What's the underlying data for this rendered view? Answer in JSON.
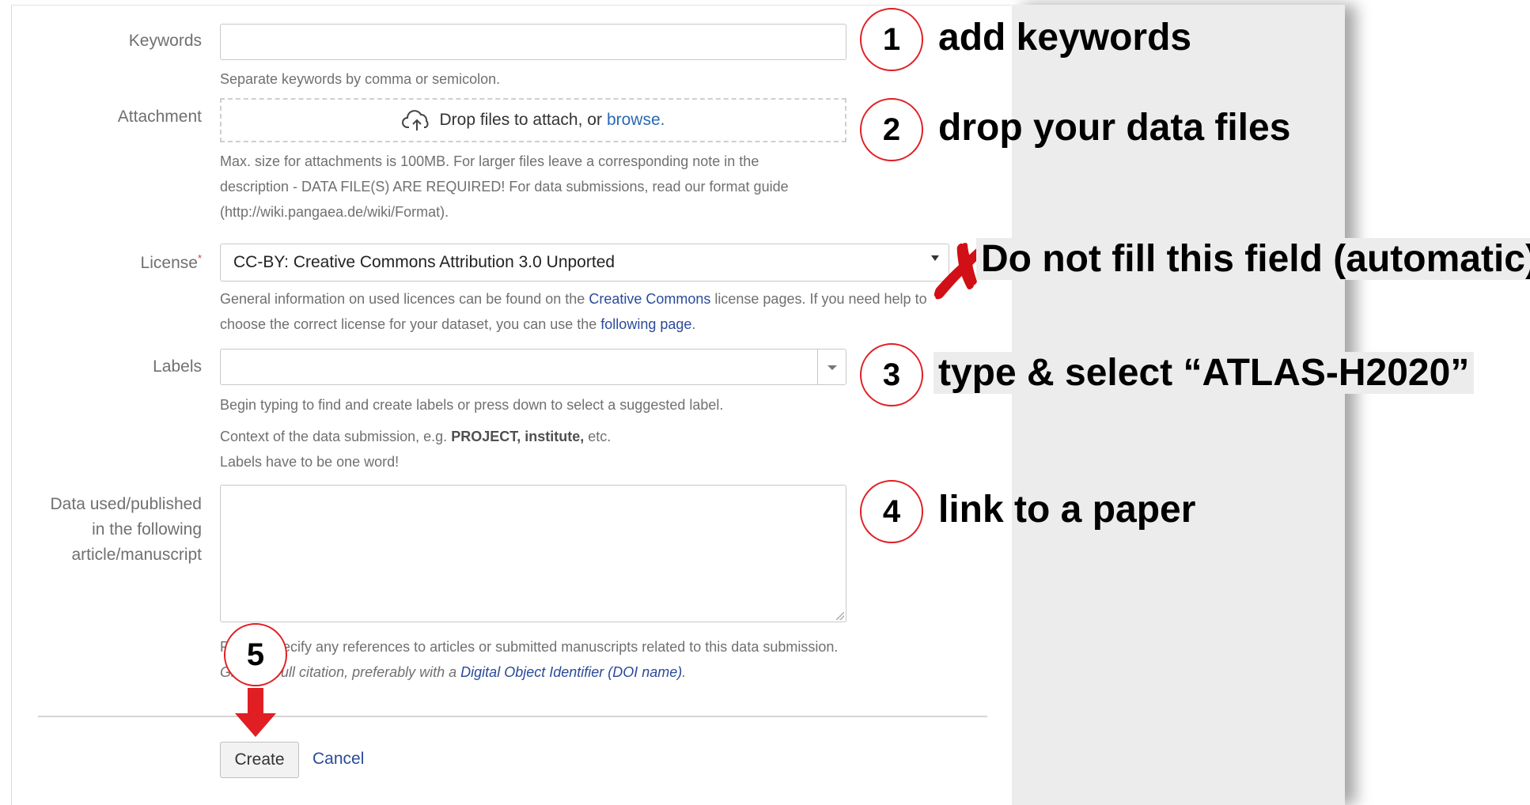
{
  "form": {
    "keywords": {
      "label": "Keywords",
      "value": "",
      "help": "Separate keywords by comma or semicolon."
    },
    "attachment": {
      "label": "Attachment",
      "drop_text": "Drop files to attach, or",
      "browse_link": "browse.",
      "help_line1": "Max. size for attachments is 100MB. For larger files leave a corresponding note in the",
      "help_line2": "description - DATA FILE(S) ARE REQUIRED! For data submissions, read our format guide",
      "help_line3": "(http://wiki.pangaea.de/wiki/Format)."
    },
    "license": {
      "label": "License",
      "required_mark": "*",
      "selected": "CC-BY: Creative Commons Attribution 3.0 Unported",
      "help_part1": "General information on used licences can be found on the",
      "help_link1": "Creative Commons",
      "help_part2": "license pages. If you need help to",
      "help_part3": "choose the correct license for your dataset, you can use the",
      "help_link2": "following page",
      "help_part4": "."
    },
    "labels": {
      "label": "Labels",
      "value": "",
      "help1": "Begin typing to find and create labels or press down to select a suggested label.",
      "help2_prefix": "Context of the data submission, e.g.",
      "help2_bold": "PROJECT, institute,",
      "help2_suffix": "etc.",
      "help3": "Labels have to be one word!"
    },
    "article": {
      "label_line1": "Data used/published",
      "label_line2": "in the following",
      "label_line3": "article/manuscript",
      "value": "",
      "help1": "Please specify any references to articles or submitted manuscripts related to this data submission.",
      "help2_prefix": "Give the full citation, preferably with a",
      "help2_link": "Digital Object Identifier (DOI name)",
      "help2_suffix": "."
    },
    "buttons": {
      "create": "Create",
      "cancel": "Cancel"
    }
  },
  "annotations": {
    "step1": {
      "number": "1",
      "text": "add keywords"
    },
    "step2": {
      "number": "2",
      "text": "drop your data files"
    },
    "license_note": {
      "mark": "✗",
      "text": "Do not fill this field (automatic)"
    },
    "step3": {
      "number": "3",
      "text": "type & select “ATLAS-H2020”"
    },
    "step4": {
      "number": "4",
      "text": "link to a paper"
    },
    "step5": {
      "number": "5"
    }
  },
  "colors": {
    "annotation_red": "#e01e24",
    "link_blue": "#2a4a9a",
    "panel_grey": "#ececec"
  }
}
